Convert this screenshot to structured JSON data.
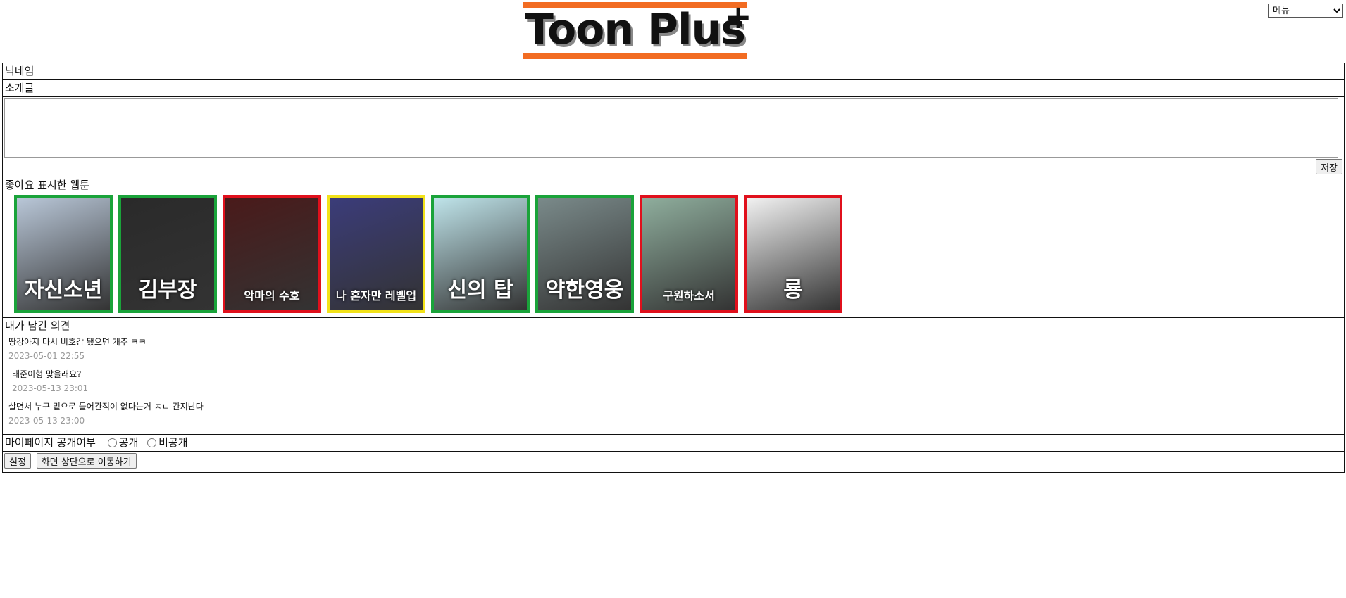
{
  "logo": {
    "text": "Toon Plus",
    "plus": "+"
  },
  "menu": {
    "selected": "메뉴"
  },
  "profile": {
    "nickname_label": "닉네임",
    "intro_label": "소개글",
    "intro_value": "",
    "save_label": "저장"
  },
  "liked": {
    "heading": "좋아요 표시한 웹툰",
    "covers": [
      {
        "title": "자신소년",
        "border": "#1aa33a",
        "bg": "#b9c7d8"
      },
      {
        "title": "김부장",
        "border": "#1aa33a",
        "bg": "#2a2a2a"
      },
      {
        "title": "악마의 수호",
        "border": "#e0101c",
        "bg": "#4a1a1a"
      },
      {
        "title": "나 혼자만 레벨업",
        "border": "#f2e21a",
        "bg": "#3b3c7a"
      },
      {
        "title": "신의 탑",
        "border": "#1aa33a",
        "bg": "#bfe4ea"
      },
      {
        "title": "약한영웅",
        "border": "#1aa33a",
        "bg": "#7a8a8a"
      },
      {
        "title": "구원하소서",
        "border": "#e0101c",
        "bg": "#8fae9d"
      },
      {
        "title": "룡",
        "border": "#e0101c",
        "bg": "#f2f2f2"
      }
    ]
  },
  "comments": {
    "heading": "내가 남긴 의견",
    "items": [
      {
        "text": "땅강아지 다시 비호감 됐으면 개추 ㅋㅋ",
        "date": "2023-05-01 22:55"
      },
      {
        "text": "태준이형 맞을래요?",
        "date": "2023-05-13 23:01"
      },
      {
        "text": "살면서 누구 밑으로 들어간적이 없다는거 ㅈㄴ 간지난다",
        "date": "2023-05-13 23:00"
      }
    ]
  },
  "privacy": {
    "label": "마이페이지 공개여부",
    "public": "공개",
    "private": "비공개"
  },
  "buttons": {
    "settings": "설정",
    "scroll_top": "화면 상단으로 이동하기"
  }
}
